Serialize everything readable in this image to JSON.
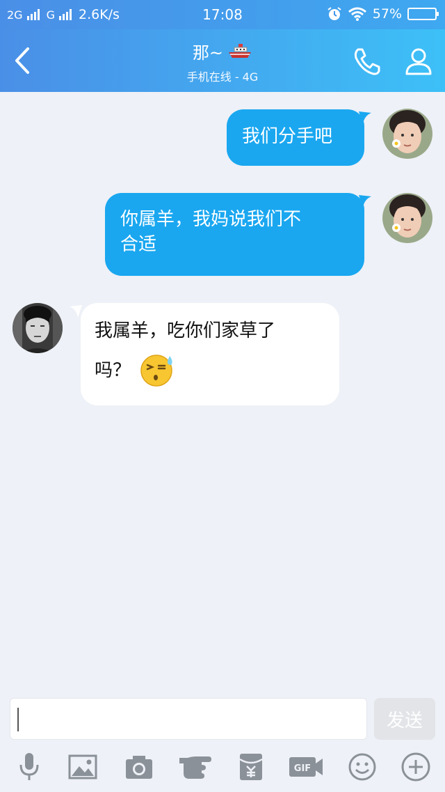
{
  "status_bar": {
    "net1": "2G",
    "net2": "G",
    "speed": "2.6K/s",
    "time": "17:08",
    "battery": "57%"
  },
  "header": {
    "title": "那~",
    "subtitle": "手机在线 - 4G"
  },
  "messages": [
    {
      "direction": "out",
      "line1": "我们分手吧",
      "line2": ""
    },
    {
      "direction": "out",
      "line1": "你属羊，我妈说我们不",
      "line2": "合适"
    },
    {
      "direction": "in",
      "line1": "我属羊，吃你们家草了",
      "line2": "吗？"
    }
  ],
  "input": {
    "value": "",
    "send_label": "发送"
  },
  "toolbar": {
    "icons": [
      "microphone-icon",
      "image-icon",
      "camera-icon",
      "hand-icon",
      "red-packet-icon",
      "gif-icon",
      "emoji-icon",
      "plus-icon"
    ]
  },
  "colors": {
    "header_start": "#4a8fe7",
    "header_end": "#3dc0f7",
    "bubble_out": "#1aa7f0",
    "bubble_in": "#ffffff",
    "background": "#eef1f7"
  }
}
